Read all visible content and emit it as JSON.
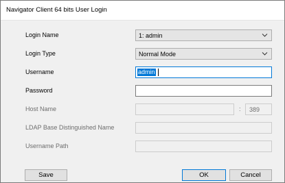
{
  "window": {
    "title": "Navigator Client 64 bits User Login"
  },
  "form": {
    "login_name": {
      "label": "Login Name",
      "value": "1: admin"
    },
    "login_type": {
      "label": "Login Type",
      "value": "Normal Mode"
    },
    "username": {
      "label": "Username",
      "value": "admin"
    },
    "password": {
      "label": "Password",
      "value": ""
    },
    "host_name": {
      "label": "Host Name",
      "value": "",
      "separator": ":",
      "port": "389"
    },
    "ldap_base_dn": {
      "label": "LDAP Base Distinguished Name",
      "value": ""
    },
    "username_path": {
      "label": "Username Path",
      "value": ""
    }
  },
  "buttons": {
    "save": "Save",
    "ok": "OK",
    "cancel": "Cancel"
  }
}
